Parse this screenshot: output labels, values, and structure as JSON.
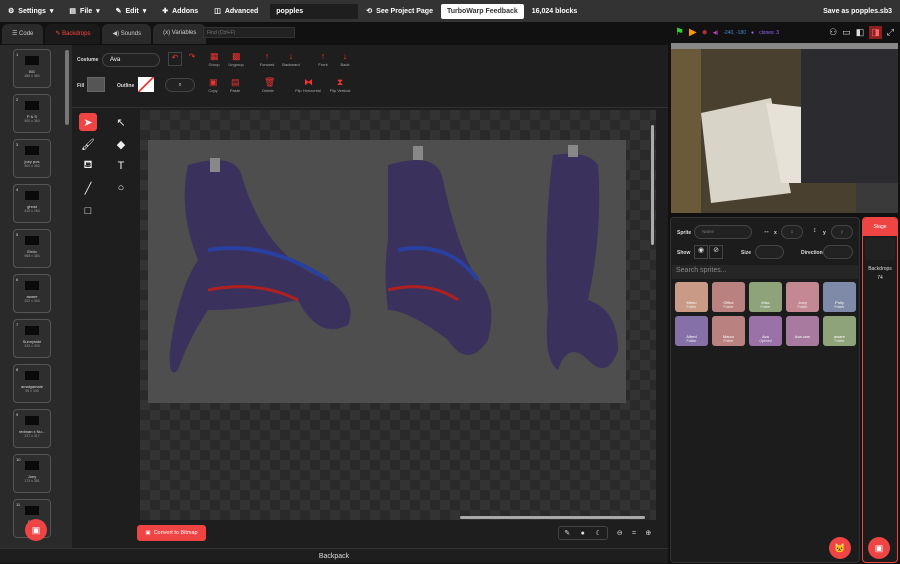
{
  "menu": {
    "settings": "Settings",
    "file": "File",
    "edit": "Edit",
    "addons": "Addons",
    "advanced": "Advanced",
    "project_title": "popples",
    "see_project": "See Project Page",
    "feedback": "TurboWarp Feedback",
    "blocks": "16,024 blocks",
    "save": "Save as popples.sb3"
  },
  "tabs": [
    {
      "label": "Code"
    },
    {
      "label": "Backdrops"
    },
    {
      "label": "Sounds"
    },
    {
      "label": "Variables"
    }
  ],
  "find_placeholder": "Find (Ctrl+F)",
  "backdrops": [
    {
      "n": "1",
      "name": "BG",
      "size": "480 x 360"
    },
    {
      "n": "2",
      "name": "P & S",
      "size": "500 x 360"
    },
    {
      "n": "3",
      "name": "joey pos",
      "size": "500 x 360"
    },
    {
      "n": "4",
      "name": "ghost",
      "size": "415 x 254"
    },
    {
      "n": "5",
      "name": "Endo",
      "size": "968 x 384"
    },
    {
      "n": "6",
      "name": "aware",
      "size": "202 x 343"
    },
    {
      "n": "7",
      "name": "Sunnyside",
      "size": "243 x 339"
    },
    {
      "n": "8",
      "name": "amalgamate",
      "size": "96 x 343"
    },
    {
      "n": "9",
      "name": "redman x Nu...",
      "size": "237 x 317"
    },
    {
      "n": "10",
      "name": "Joey",
      "size": "173 x 381"
    },
    {
      "n": "11",
      "name": "Ev...",
      "size": ""
    }
  ],
  "editor": {
    "costume_label": "Costume",
    "costume_name": "Ava",
    "fill_label": "Fill",
    "outline_label": "Outline",
    "outline_width": "0",
    "buttons": {
      "group": "Group",
      "ungroup": "Ungroup",
      "forward": "Forward",
      "backward": "Backward",
      "front": "Front",
      "back": "Back",
      "copy": "Copy",
      "paste": "Paste",
      "delete": "Delete",
      "flip_h": "Flip Horizontal",
      "flip_v": "Flip Vertical"
    },
    "convert": "Convert to Bitmap"
  },
  "stage_bar": {
    "coords": "-240, -180",
    "clones": "clones: 3"
  },
  "sprite_info": {
    "sprite_label": "Sprite",
    "name_placeholder": "Name",
    "x_label": "x",
    "x_placeholder": "x",
    "y_label": "y",
    "y_placeholder": "y",
    "show_label": "Show",
    "size_label": "Size",
    "direction_label": "Direction",
    "search_placeholder": "Search sprites..."
  },
  "sprites": [
    {
      "name": "Menu",
      "sub": "Folder",
      "color": "#c99a85"
    },
    {
      "name": "Office",
      "sub": "Folder",
      "color": "#b9817f"
    },
    {
      "name": "Misc",
      "sub": "Folder",
      "color": "#8ea37a"
    },
    {
      "name": "Joey",
      "sub": "Folder",
      "color": "#c48893"
    },
    {
      "name": "Polly",
      "sub": "Folder",
      "color": "#7f8aa8"
    },
    {
      "name": "Alfred",
      "sub": "Folder",
      "color": "#8571a8"
    },
    {
      "name": "Marzo",
      "sub": "Folder",
      "color": "#b9817f"
    },
    {
      "name": "Ava",
      "sub": "Opened",
      "color": "#9a72a8"
    },
    {
      "name": "Ava cam",
      "sub": "",
      "color": "#a97aa0"
    },
    {
      "name": "aware",
      "sub": "Folder",
      "color": "#8ea37a"
    }
  ],
  "stage_panel": {
    "title": "Stage",
    "backdrops_label": "Backdrops",
    "count": "74"
  },
  "backpack": "Backpack",
  "colors": {
    "accent": "#e44444",
    "art_purple": "#3a2f5e"
  }
}
